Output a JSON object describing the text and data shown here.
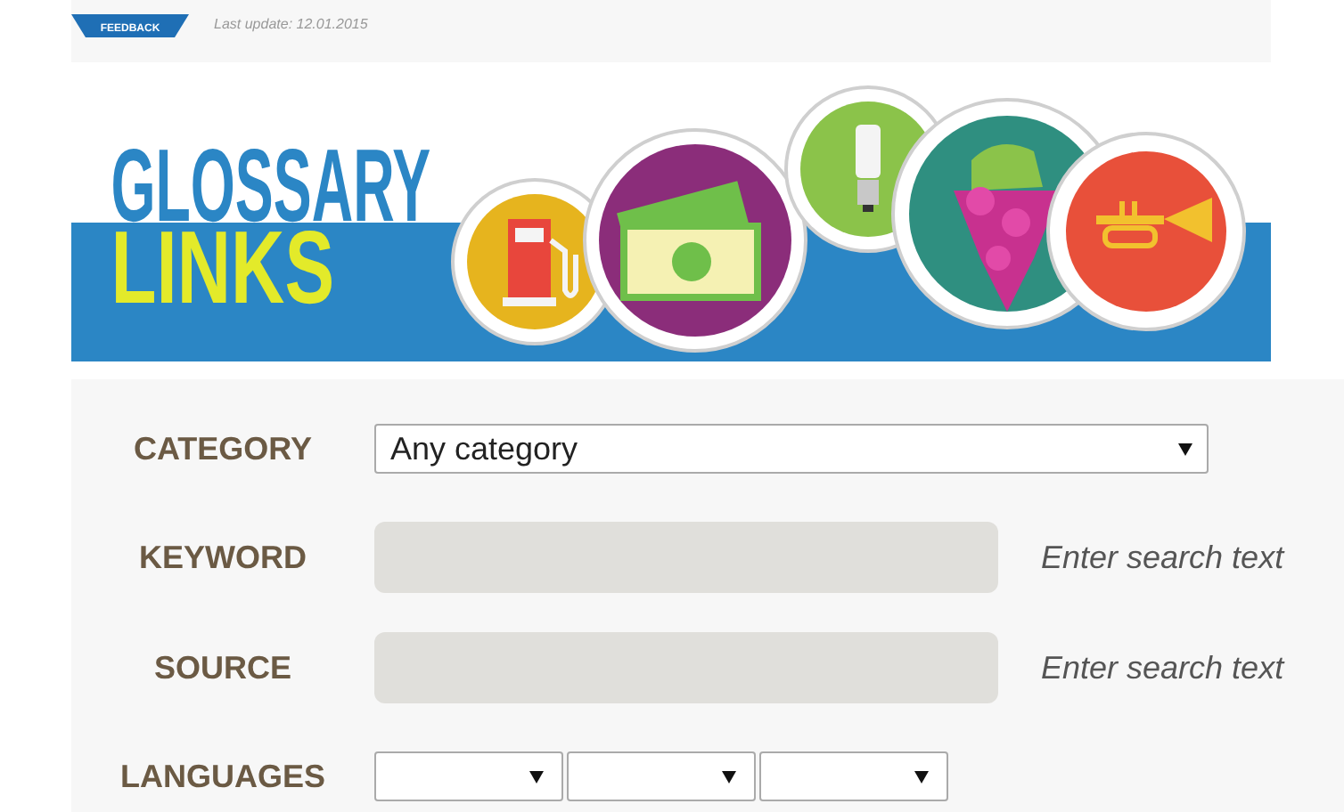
{
  "header": {
    "feedback_tab": "FEEDBACK",
    "last_update": "Last update: 12.01.2015"
  },
  "banner": {
    "title_lines": [
      "GLOSSARY",
      "LINKS"
    ]
  },
  "form": {
    "rows": [
      {
        "kind": "select",
        "label": "CATEGORY",
        "value": "Any category"
      },
      {
        "kind": "text",
        "label": "KEYWORD",
        "hint": "Enter search text"
      },
      {
        "kind": "text",
        "label": "SOURCE",
        "hint": "Enter search text"
      },
      {
        "kind": "multi-select",
        "label": "LANGUAGES"
      }
    ]
  }
}
